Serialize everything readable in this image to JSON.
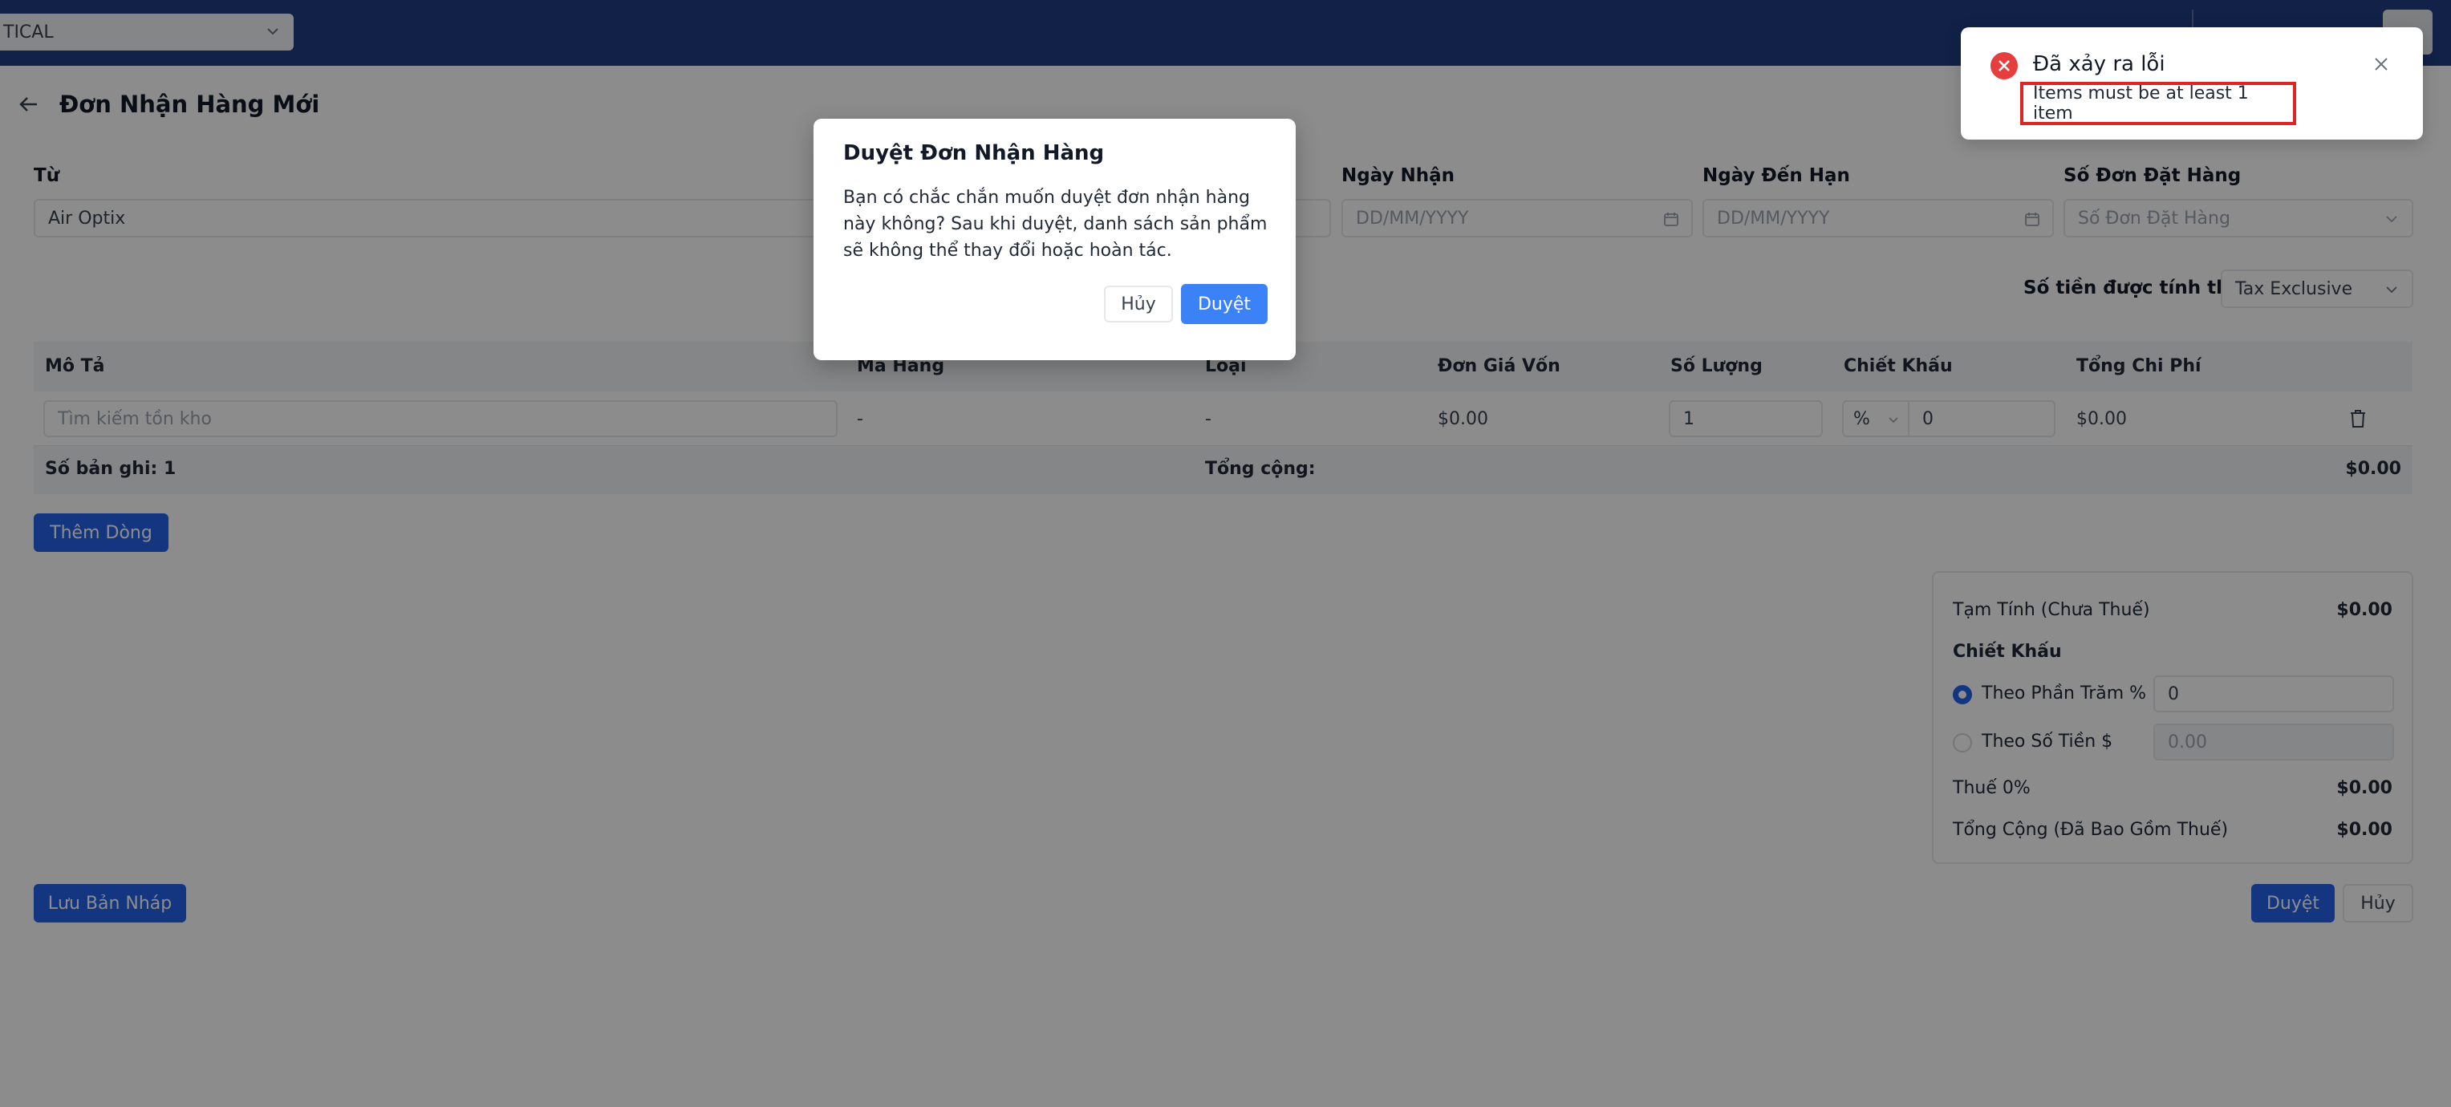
{
  "topbar": {
    "store_name": "TICAL"
  },
  "page": {
    "title": "Đơn Nhận Hàng Mới"
  },
  "form": {
    "from_label": "Từ",
    "from_value": "Air Optix",
    "receive_date_label": "Ngày Nhận",
    "receive_date_placeholder": "DD/MM/YYYY",
    "due_date_label": "Ngày Đến Hạn",
    "due_date_placeholder": "DD/MM/YYYY",
    "po_label": "Số Đơn Đặt Hàng",
    "po_placeholder": "Số Đơn Đặt Hàng",
    "amount_basis_label": "Số tiền được tính theo",
    "amount_basis_value": "Tax Exclusive"
  },
  "table": {
    "headers": [
      "Mô Tả",
      "Mã Hàng",
      "Loại",
      "Đơn Giá Vốn",
      "Số Lượng",
      "Chiết Khấu",
      "Tổng Chi Phí"
    ],
    "row": {
      "search_placeholder": "Tìm kiếm tồn kho",
      "code": "-",
      "type": "-",
      "unit_cost": "$0.00",
      "quantity": "1",
      "discount_type": "%",
      "discount_value": "0",
      "total": "$0.00"
    },
    "footer": {
      "record_count": "Số bản ghi: 1",
      "total_label": "Tổng cộng:",
      "total_value": "$0.00"
    },
    "add_row_label": "Thêm Dòng"
  },
  "summary": {
    "subtotal_label": "Tạm Tính (Chưa Thuế)",
    "subtotal_value": "$0.00",
    "discount_heading": "Chiết Khấu",
    "by_percent_label": "Theo Phần Trăm %",
    "by_percent_value": "0",
    "by_amount_label": "Theo Số Tiền $",
    "by_amount_placeholder": "0.00",
    "tax_label": "Thuế 0%",
    "tax_value": "$0.00",
    "grand_total_label": "Tổng Cộng (Đã Bao Gồm Thuế)",
    "grand_total_value": "$0.00"
  },
  "actions": {
    "save_draft": "Lưu Bản Nháp",
    "approve": "Duyệt",
    "cancel": "Hủy"
  },
  "modal": {
    "title": "Duyệt Đơn Nhận Hàng",
    "body": "Bạn có chắc chắn muốn duyệt đơn nhận hàng này không? Sau khi duyệt, danh sách sản phẩm sẽ không thể thay đổi hoặc hoàn tác.",
    "cancel_label": "Hủy",
    "confirm_label": "Duyệt"
  },
  "toast": {
    "title": "Đã xảy ra lỗi",
    "message": "Items must be at least 1 item"
  },
  "colors": {
    "topbar": "#1f3d82",
    "primary": "#2563eb",
    "modal_confirm": "#3b82f6",
    "error": "#e53e3e"
  }
}
